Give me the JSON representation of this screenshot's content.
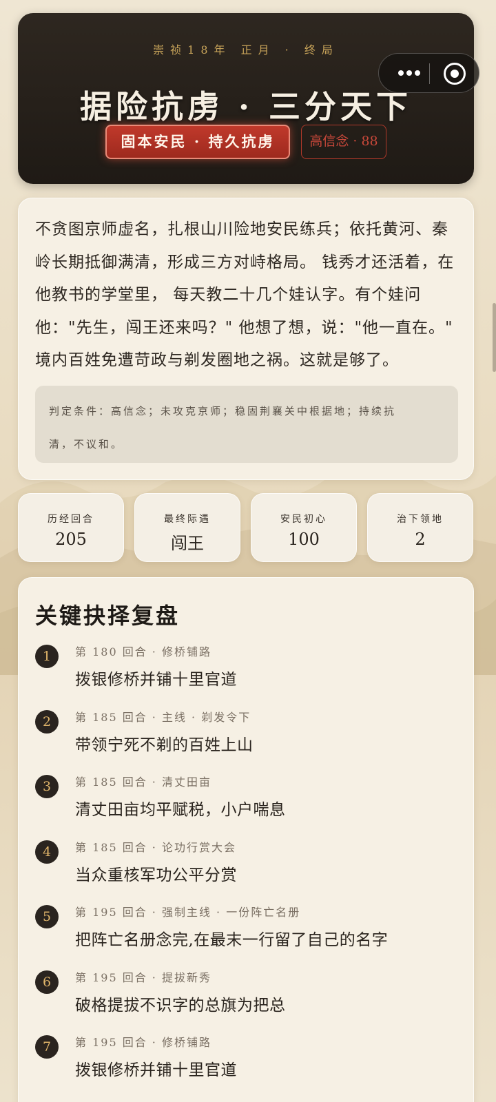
{
  "hero": {
    "date": "崇祯18年 正月 · 终局",
    "title": "据险抗虏 · 三分天下",
    "tag_primary": "固本安民 · 持久抗虏",
    "tag_score": "高信念 · 88"
  },
  "capsule": {
    "more_icon": "more-dots-icon",
    "close_icon": "target-icon"
  },
  "story": {
    "lines": [
      "不贪图京师虚名，扎根山川险地安民练兵；依托黄河、秦",
      "岭长期抵御满清，形成三方对峙格局。 钱秀才还活着，在",
      "他教书的学堂里， 每天教二十几个娃认字。有个娃问",
      "他：\"先生，闯王还来吗？\" 他想了想，说：\"他一直在。\"",
      "境内百姓免遭苛政与剃发圈地之祸。这就是够了。"
    ],
    "verdict_line1": "判定条件：高信念；未攻克京师；稳固荆襄关中根据地；持续抗",
    "verdict_line2": "清，不议和。"
  },
  "stats": [
    {
      "label": "历经回合",
      "value": "205"
    },
    {
      "label": "最终际遇",
      "value": "闯王"
    },
    {
      "label": "安民初心",
      "value": "100"
    },
    {
      "label": "治下领地",
      "value": "2"
    }
  ],
  "review": {
    "title": "关键抉择复盘",
    "items": [
      {
        "num": "1",
        "meta": "第 180 回合 · 修桥铺路",
        "text": "拨银修桥并铺十里官道"
      },
      {
        "num": "2",
        "meta": "第 185 回合 · 主线 · 剃发令下",
        "text": "带领宁死不剃的百姓上山"
      },
      {
        "num": "3",
        "meta": "第 185 回合 · 清丈田亩",
        "text": "清丈田亩均平赋税，小户喘息"
      },
      {
        "num": "4",
        "meta": "第 185 回合 · 论功行赏大会",
        "text": "当众重核军功公平分赏"
      },
      {
        "num": "5",
        "meta": "第 195 回合 · 强制主线 · 一份阵亡名册",
        "text": "把阵亡名册念完,在最末一行留了自己的名字"
      },
      {
        "num": "6",
        "meta": "第 195 回合 · 提拔新秀",
        "text": "破格提拔不识字的总旗为把总"
      },
      {
        "num": "7",
        "meta": "第 195 回合 · 修桥铺路",
        "text": "拨银修桥并铺十里官道"
      }
    ]
  }
}
